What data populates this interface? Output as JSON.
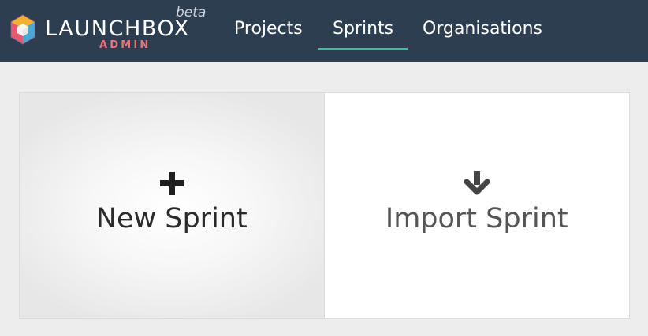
{
  "header": {
    "brand": "LAUNCHBOX",
    "beta": "beta",
    "admin": "ADMIN",
    "logo_icon": "hexagon-cube-logo-icon",
    "nav": [
      {
        "label": "Projects",
        "active": false
      },
      {
        "label": "Sprints",
        "active": true
      },
      {
        "label": "Organisations",
        "active": false
      }
    ],
    "colors": {
      "bar": "#2d3e50",
      "active_underline": "#28c8a0",
      "admin": "#e9727b"
    }
  },
  "actions": {
    "new_sprint": {
      "label": "New Sprint",
      "icon": "plus-icon"
    },
    "import_sprint": {
      "label": "Import Sprint",
      "icon": "arrow-down-icon"
    }
  }
}
